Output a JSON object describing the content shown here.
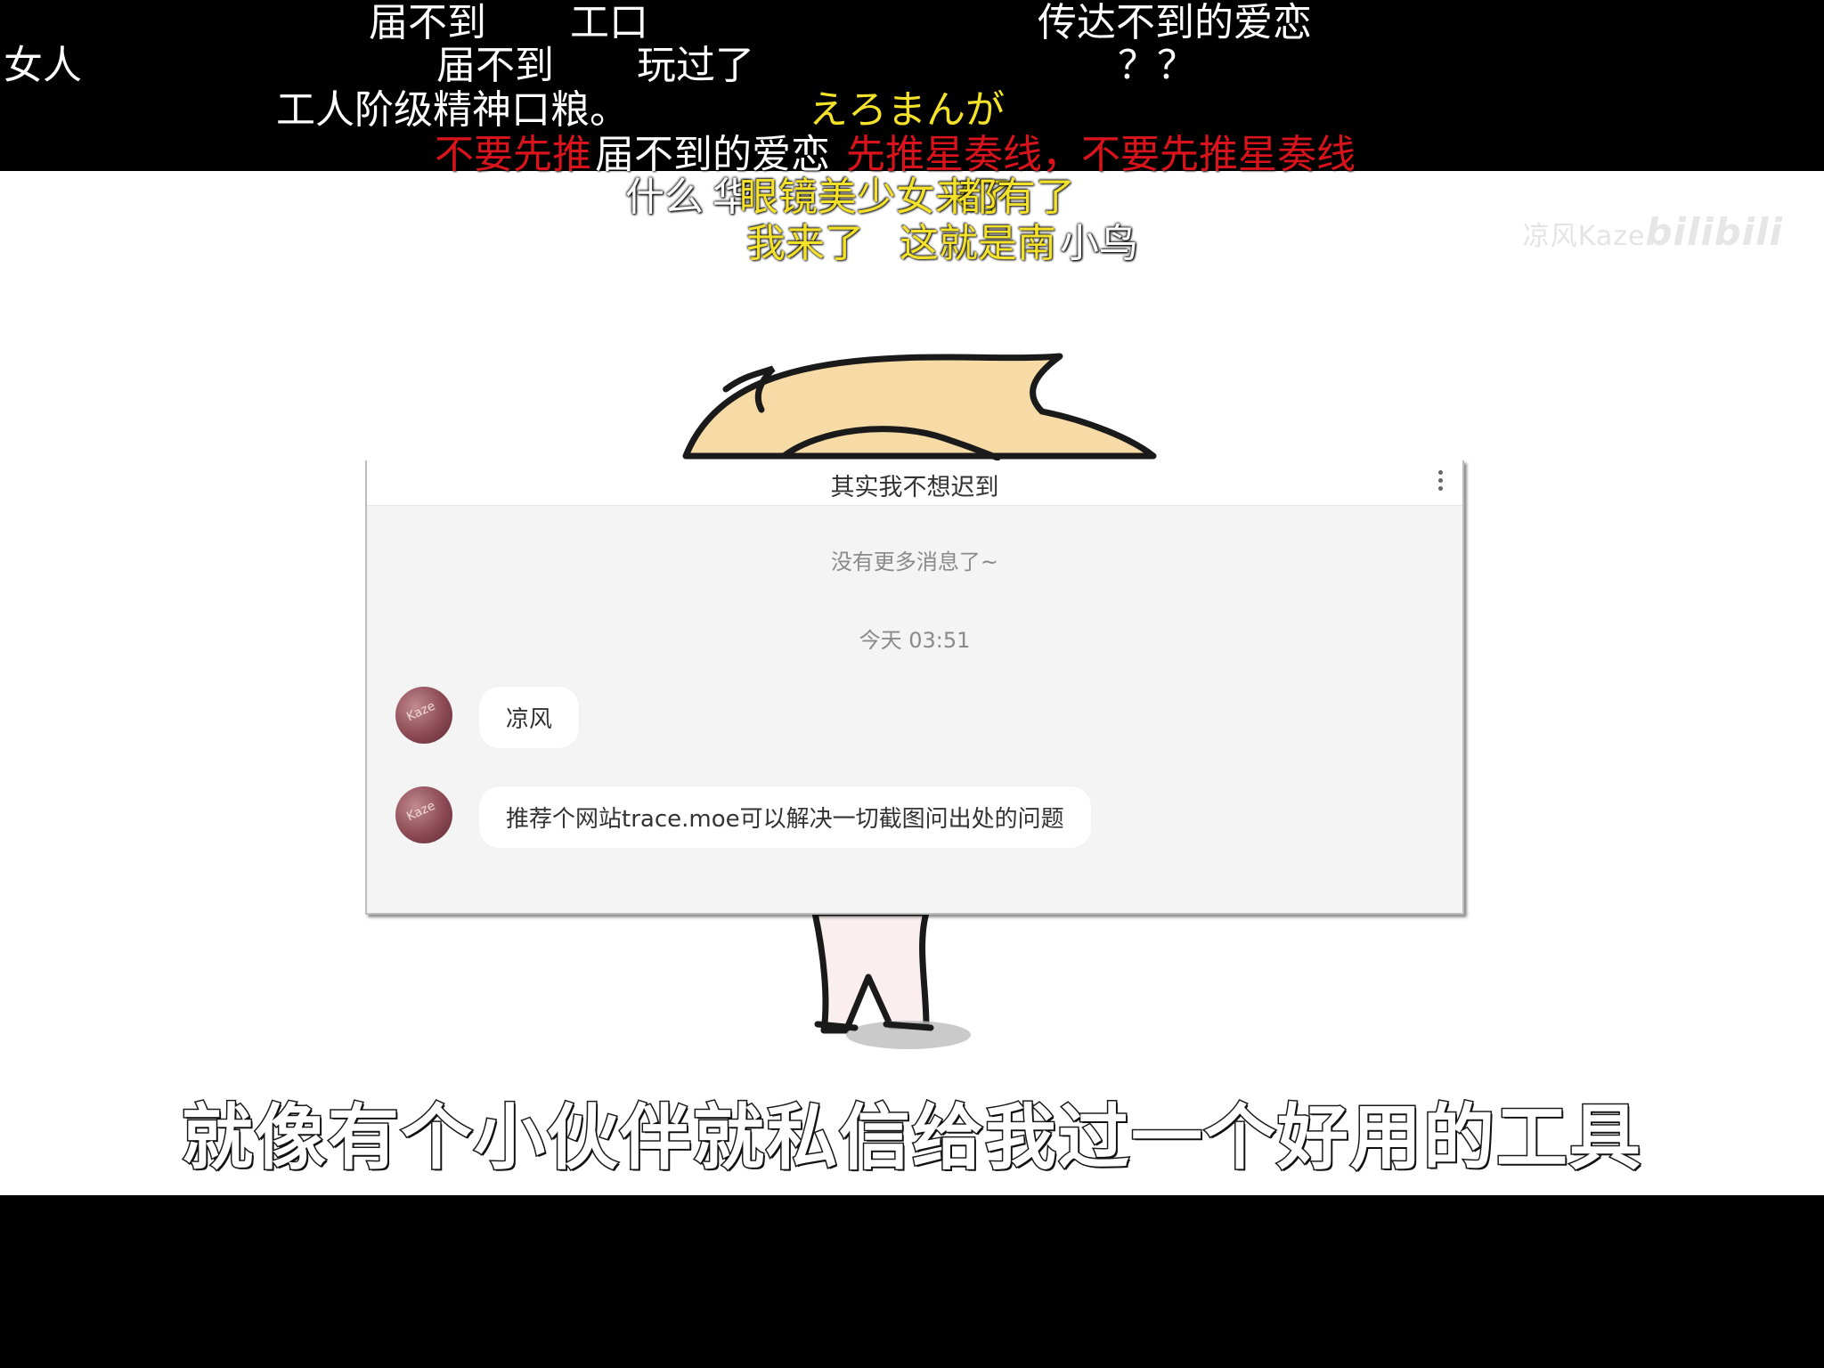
{
  "danmaku": [
    {
      "id": "d1",
      "text": "届不到",
      "color": "white"
    },
    {
      "id": "d2",
      "text": "工口",
      "color": "white"
    },
    {
      "id": "d3",
      "text": "传达不到的爱恋",
      "color": "white"
    },
    {
      "id": "d4",
      "text": "女人",
      "color": "white"
    },
    {
      "id": "d5",
      "text": "届不到",
      "color": "white"
    },
    {
      "id": "d6",
      "text": "玩过了",
      "color": "white"
    },
    {
      "id": "d7",
      "text": "？？",
      "color": "white"
    },
    {
      "id": "d8",
      "text": "工人阶级精神口粮。",
      "color": "white"
    },
    {
      "id": "d9",
      "text": "えろまんが",
      "color": "yellow"
    },
    {
      "id": "d10",
      "text": "不要先推",
      "color": "red"
    },
    {
      "id": "d11",
      "text": "届不到的爱恋",
      "color": "white"
    },
    {
      "id": "d12",
      "text": "先推星奏线，不要先推星奏线",
      "color": "red"
    },
    {
      "id": "d13",
      "text": "什么",
      "color": "light"
    },
    {
      "id": "d14",
      "text": "眼镜美少女来了",
      "color": "yellow"
    },
    {
      "id": "d15",
      "text": "华",
      "color": "light"
    },
    {
      "id": "d16",
      "text": "都有了",
      "color": "yellow"
    },
    {
      "id": "d17",
      "text": "我来了",
      "color": "yellow"
    },
    {
      "id": "d18",
      "text": "小鸟",
      "color": "light"
    },
    {
      "id": "d19",
      "text": "这就是南",
      "color": "yellow"
    }
  ],
  "watermark": {
    "text": "凉风Kaze",
    "logo": "bilibili"
  },
  "chat": {
    "title": "其实我不想迟到",
    "no_more": "没有更多消息了~",
    "timestamp": "今天 03:51",
    "messages": [
      {
        "text": "凉风"
      },
      {
        "text": "推荐个网站trace.moe可以解决一切截图问出处的问题"
      }
    ]
  },
  "subtitle": "就像有个小伙伴就私信给我过一个好用的工具"
}
